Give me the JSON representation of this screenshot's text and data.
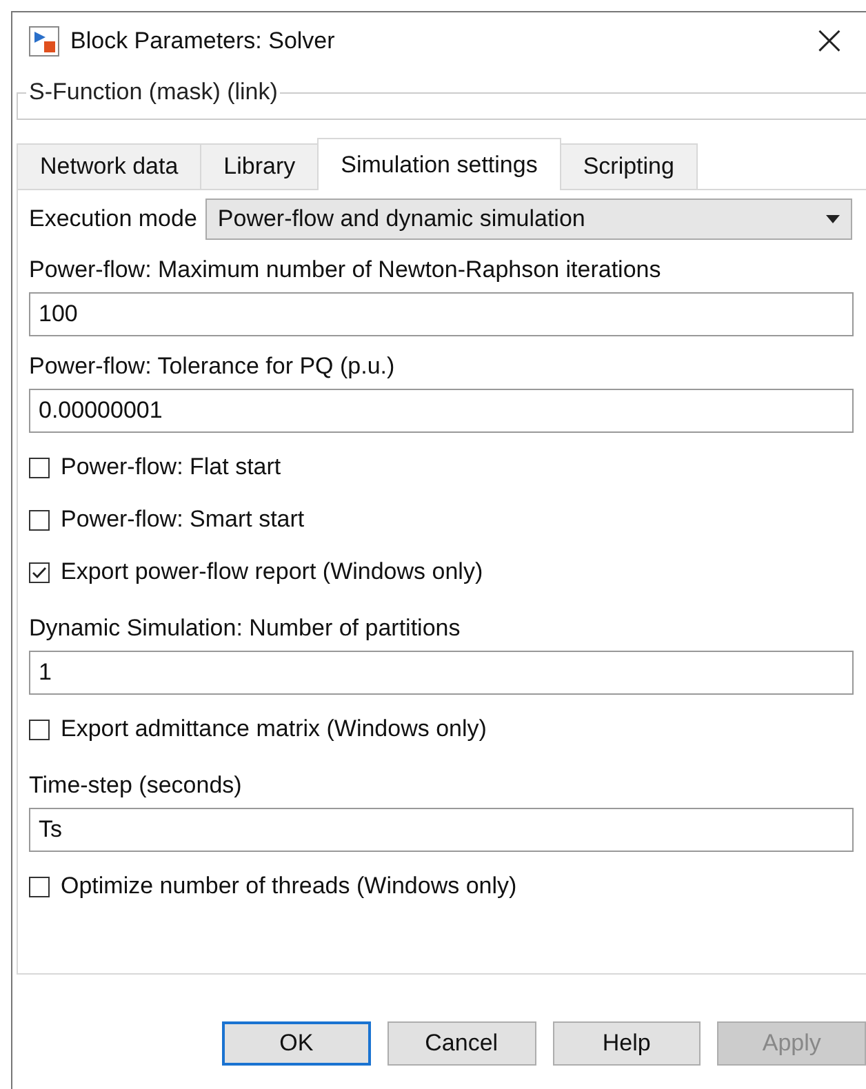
{
  "window": {
    "title": "Block Parameters: Solver",
    "close": "×"
  },
  "group": {
    "title": "S-Function (mask) (link)"
  },
  "tabs": [
    {
      "label": "Network data",
      "selected": false
    },
    {
      "label": "Library",
      "selected": false
    },
    {
      "label": "Simulation settings",
      "selected": true
    },
    {
      "label": "Scripting",
      "selected": false
    }
  ],
  "parameters": [
    {
      "kind": "dropdown",
      "label": "Execution mode",
      "value": "Power-flow and dynamic simulation"
    },
    {
      "kind": "field",
      "label": "Power-flow: Maximum number of Newton-Raphson iterations",
      "value": "100"
    },
    {
      "kind": "field",
      "label": "Power-flow: Tolerance for PQ (p.u.)",
      "value": "0.00000001"
    },
    {
      "kind": "checkbox",
      "label": "Power-flow: Flat start",
      "checked": false
    },
    {
      "kind": "checkbox",
      "label": "Power-flow: Smart start",
      "checked": false
    },
    {
      "kind": "checkbox",
      "label": "Export power-flow report (Windows only)",
      "checked": true
    },
    {
      "kind": "field",
      "label": "Dynamic Simulation: Number of partitions",
      "value": "1"
    },
    {
      "kind": "checkbox",
      "label": "Export admittance matrix (Windows only)",
      "checked": false
    },
    {
      "kind": "field",
      "label": "Time-step (seconds)",
      "value": "Ts"
    },
    {
      "kind": "checkbox",
      "label": "Optimize number of threads (Windows only)",
      "checked": false
    }
  ],
  "buttons": [
    {
      "label": "OK",
      "default": true,
      "disabled": false
    },
    {
      "label": "Cancel",
      "default": false,
      "disabled": false
    },
    {
      "label": "Help",
      "default": false,
      "disabled": false
    },
    {
      "label": "Apply",
      "default": false,
      "disabled": true
    }
  ]
}
